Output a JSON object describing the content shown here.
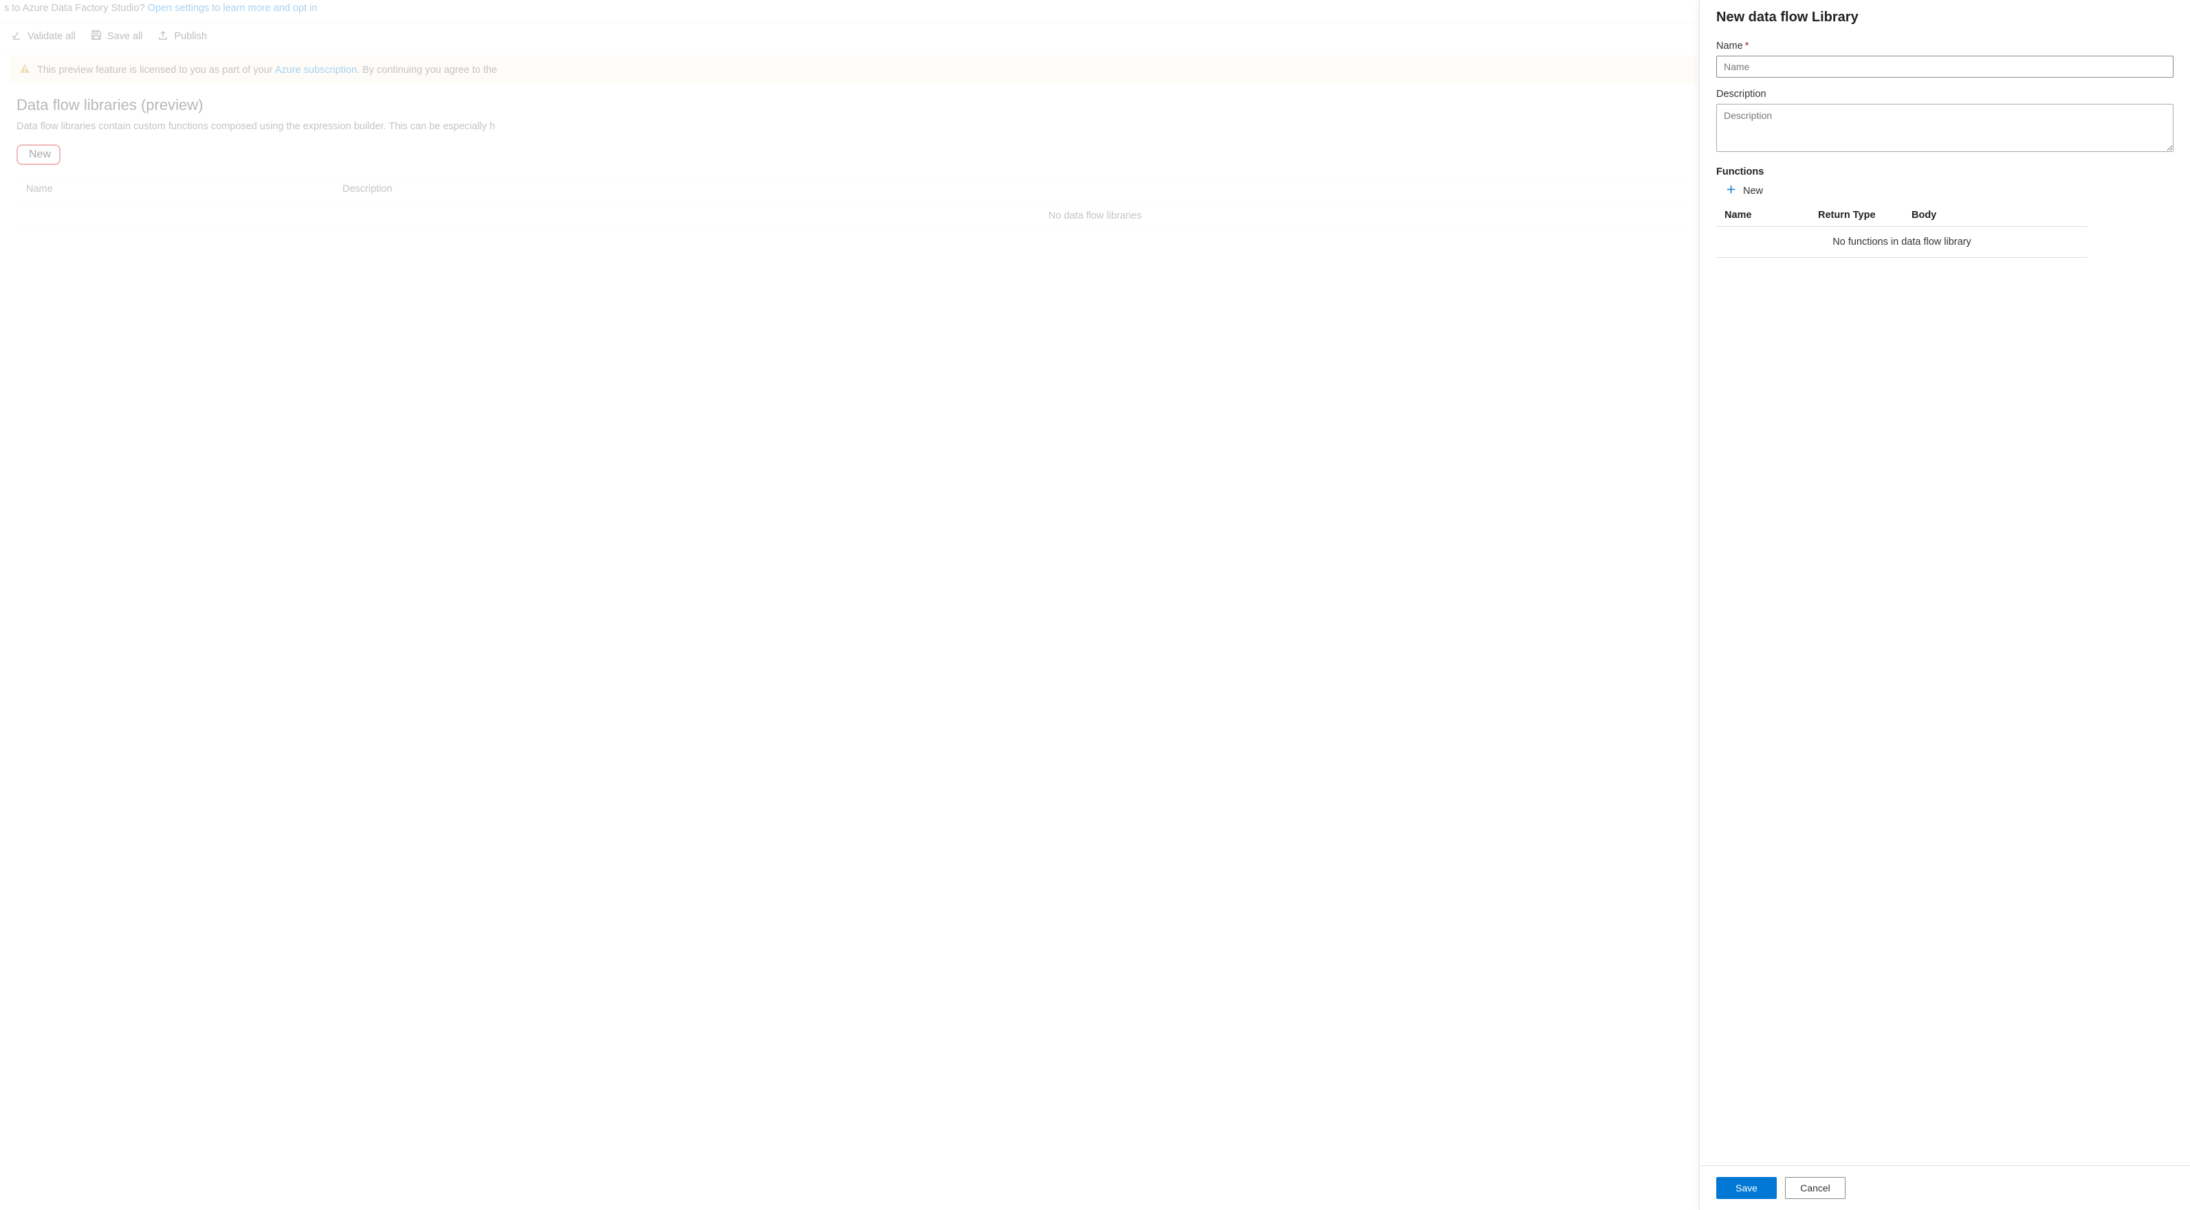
{
  "topBanner": {
    "prefix": "s to Azure Data Factory Studio? ",
    "linkText": "Open settings to learn more and opt in"
  },
  "toolbar": {
    "validateAll": "Validate all",
    "saveAll": "Save all",
    "publish": "Publish"
  },
  "infoBanner": {
    "prefix": "This preview feature is licensed to you as part of your ",
    "linkText": "Azure subscription",
    "suffix": ". By continuing you agree to the"
  },
  "page": {
    "title": "Data flow libraries (preview)",
    "subtitle": "Data flow libraries contain custom functions composed using the expression builder. This can be especially h",
    "newLabel": "New",
    "tableHeaders": {
      "name": "Name",
      "description": "Description"
    },
    "emptyMessage": "No data flow libraries"
  },
  "panel": {
    "title": "New data flow Library",
    "nameLabel": "Name",
    "namePlaceholder": "Name",
    "descLabel": "Description",
    "descPlaceholder": "Description",
    "functionsLabel": "Functions",
    "newFnLabel": "New",
    "fnHeaders": {
      "name": "Name",
      "returnType": "Return Type",
      "body": "Body"
    },
    "fnEmpty": "No functions in data flow library",
    "saveLabel": "Save",
    "cancelLabel": "Cancel"
  }
}
